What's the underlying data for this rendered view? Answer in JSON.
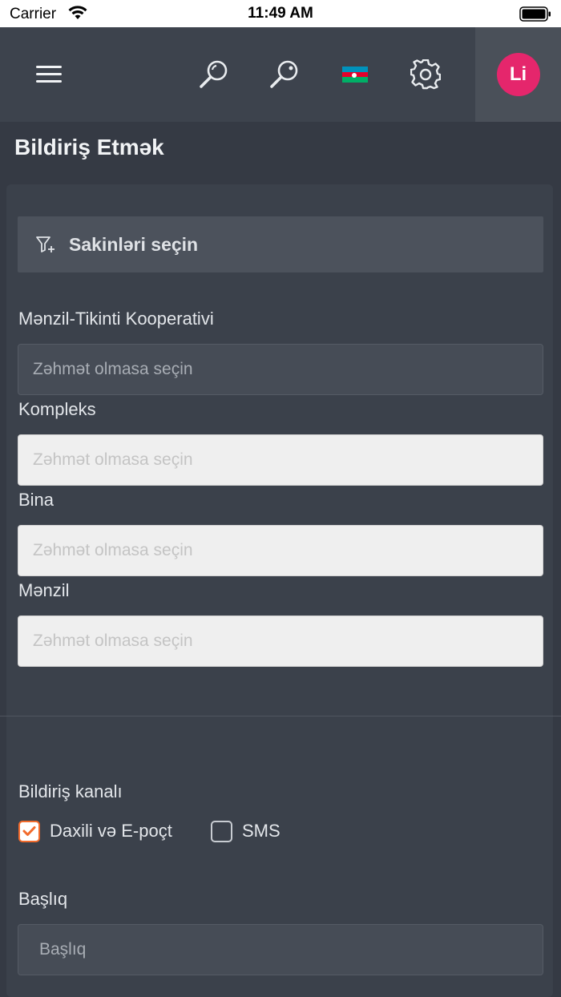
{
  "status_bar": {
    "carrier": "Carrier",
    "time": "11:49 AM"
  },
  "header": {
    "icons": [
      "menu-icon",
      "search-icon",
      "search-icon",
      "azerbaijan-flag-icon",
      "gear-icon"
    ],
    "avatar_initials": "Li",
    "avatar_color": "#e5266c",
    "flag_colors": [
      "#0092bc",
      "#e4002b",
      "#00af66"
    ]
  },
  "page": {
    "title": "Bildiriş Etmək"
  },
  "filter": {
    "label": "Sakinləri seçin",
    "icon": "filter-plus-icon"
  },
  "fields": {
    "cooperative": {
      "label": "Mənzil-Tikinti Kooperativi",
      "placeholder": "Zəhmət olmasa seçin"
    },
    "complex": {
      "label": "Kompleks",
      "placeholder": "Zəhmət olmasa seçin"
    },
    "building": {
      "label": "Bina",
      "placeholder": "Zəhmət olmasa seçin"
    },
    "apartment": {
      "label": "Mənzil",
      "placeholder": "Zəhmət olmasa seçin"
    }
  },
  "channel": {
    "label": "Bildiriş kanalı",
    "options": [
      {
        "label": "Daxili və E-poçt",
        "checked": true
      },
      {
        "label": "SMS",
        "checked": false
      }
    ],
    "accent": "#f26b2c"
  },
  "title_field": {
    "label": "Başlıq",
    "placeholder": "Başlıq"
  }
}
